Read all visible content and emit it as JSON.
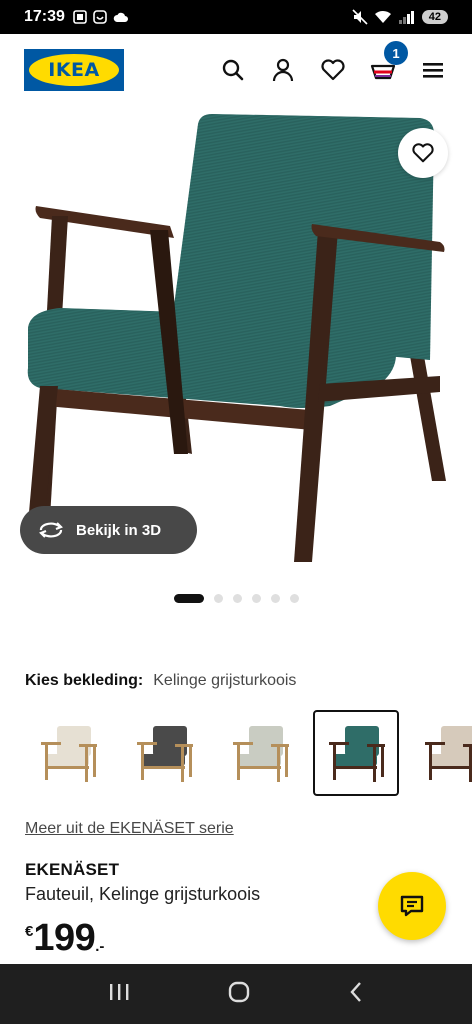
{
  "status": {
    "time": "17:39",
    "battery": "42"
  },
  "header": {
    "logo_text": "IKEA",
    "cart_count": "1"
  },
  "gallery": {
    "view_3d_label": "Bekijk in 3D",
    "dot_count": 6,
    "active_dot": 0
  },
  "upholstery": {
    "label": "Kies bekleding:",
    "value": "Kelinge grijsturkoois",
    "swatches": [
      {
        "name": "beige",
        "seat": "#e6e0d3",
        "frame": "#b58f5a",
        "selected": false
      },
      {
        "name": "dark-grey",
        "seat": "#4a4a4a",
        "frame": "#b58f5a",
        "selected": false
      },
      {
        "name": "light-grey",
        "seat": "#c9ccc2",
        "frame": "#b58f5a",
        "selected": false
      },
      {
        "name": "grey-turquoise",
        "seat": "#2f6d68",
        "frame": "#4a2a1c",
        "selected": true
      },
      {
        "name": "light-beige",
        "seat": "#d6cabb",
        "frame": "#4a2a1c",
        "selected": false
      }
    ]
  },
  "product": {
    "series_link": "Meer uit de EKENÄSET serie",
    "name": "EKENÄSET",
    "description": "Fauteuil, Kelinge grijsturkoois",
    "price_currency": "€",
    "price_int": "199",
    "price_dec": ".-"
  },
  "colors": {
    "ikea_blue": "#0058a3",
    "ikea_yellow": "#ffdb00",
    "fabric": "#2f6d68",
    "wood": "#4a2a1c"
  }
}
